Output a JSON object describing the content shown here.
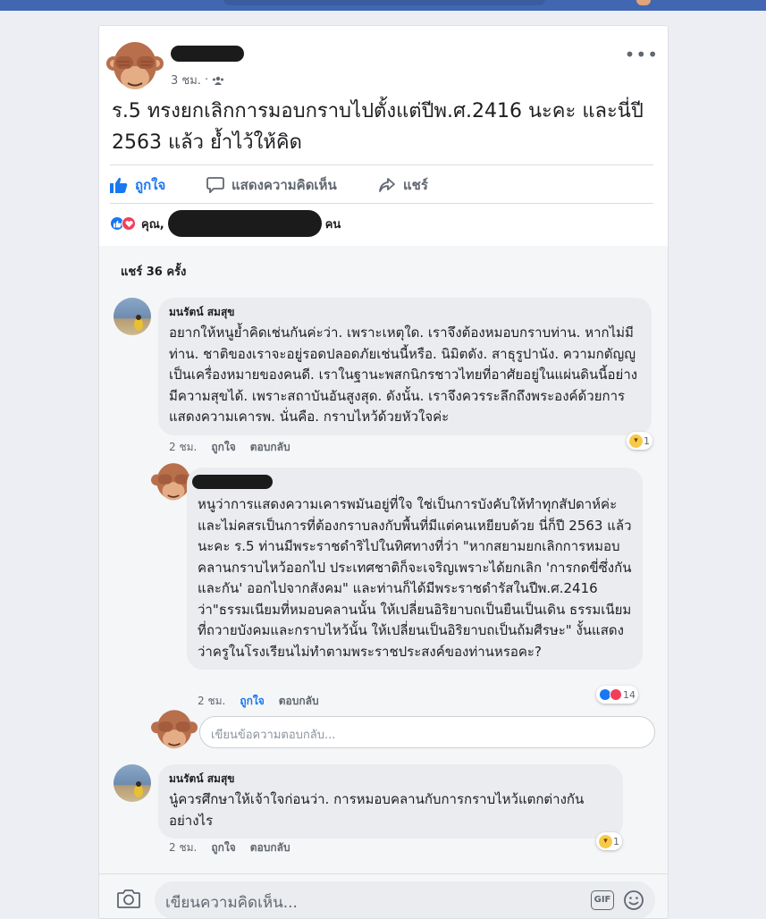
{
  "post": {
    "author_name": "",
    "time": "3 ชม.",
    "audience_icon": "friends-icon",
    "more_icon": "more-dots-icon",
    "text": "ร.5 ทรงยกเลิกการมอบกราบไปตั้งแต่ปีพ.ศ.2416 นะคะ และนี่ปี 2563 แล้ว ย้ำไว้ให้คิด"
  },
  "actions": {
    "like_label": "ถูกใจ",
    "comment_label": "แสดงความคิดเห็น",
    "share_label": "แชร์"
  },
  "reactions": {
    "icons": [
      "like-icon",
      "love-icon"
    ],
    "prefix": "คุณ,",
    "suffix": "คน"
  },
  "shares_text": "แชร์ 36 ครั้ง",
  "comments": [
    {
      "author": "มนรัตน์ สมสุข",
      "text": "อยากให้หนูย้ำคิดเช่นกันค่ะว่า. เพราะเหตุใด. เราจึงต้องหมอบกราบท่าน. หากไม่มีท่าน. ชาติของเราจะอยู่รอดปลอดภัยเช่นนี้หรือ. นิมิตดัง.  สาธุรูปานัง. ความกตัญญูเป็นเครื่องหมายของคนดี.  เราในฐานะพสกนิกรชาวไทยที่อาศัยอยู่ในแผ่นดินนี้อย่างมีความสุขได้. เพราะสถาบันอันสูงสุด.  ดังนั้น.  เราจึงควรระลึกถึงพระองค์ด้วยการแสดงความเคารพ. นั่นคือ.  กราบไหว้ด้วยหัวใจค่ะ",
      "time": "2 ชม.",
      "like": "ถูกใจ",
      "reply": "ตอบกลับ",
      "reaction_count": "1"
    },
    {
      "author": "",
      "text": "หนูว่าการแสดงความเคารพมันอยู่ที่ใจ ใช่เป็นการบังคับให้ทำทุกสัปดาห์ค่ะ และไม่คสรเป็นการที่ต้องกราบลงกับพื้นที่มีแต่คนเหยียบด้วย นี่ก็ปี 2563 แล้วนะคะ ร.5 ท่านมีพระราชดำริไปในทิศทางที่ว่า \"หากสยามยกเลิกการหมอบคลานกราบไหว้ออกไป ประเทศชาติก็จะเจริญเพราะได้ยกเลิก 'การกดขี่ซึ่งกันและกัน' ออกไปจากสังคม\" และท่านก็ได้มีพระราชดำรัสในปีพ.ศ.2416 ว่า\"ธรรมเนียมที่หมอบคลานนั้น ให้เปลี่ยนอิริยาบถเป็นยืนเป็นเดิน ธรรมเนียมที่ถวายบังคมและกราบไหว้นั้น ให้เปลี่ยนเป็นอิริยาบถเป็นถ้มศีรษะ\" งั้นแสดงว่าครูในโรงเรียนไม่ทำตามพระราชประสงค์ของท่านหรอคะ?",
      "time": "2 ชม.",
      "like": "ถูกใจ",
      "reply": "ตอบกลับ",
      "reaction_count": "14"
    },
    {
      "author": "มนรัตน์ สมสุข",
      "text": "นู๋ควรศึกษาให้เจ้าใจก่อนว่า. การหมอบคลานกับการกราบไหว้แตกต่างกันอย่างไร",
      "time": "2 ชม.",
      "like": "ถูกใจ",
      "reply": "ตอบกลับ",
      "reaction_count": "1"
    }
  ],
  "reply_placeholder": "เขียนข้อความตอบกลับ...",
  "compose": {
    "placeholder": "เขียนความคิดเห็น...",
    "camera_icon": "camera-icon",
    "gif_label": "GIF",
    "emoji_icon": "smiley-icon"
  },
  "colors": {
    "brand": "#4267b2",
    "link": "#1877f2",
    "like_red": "#f33e58",
    "haha_yellow": "#f7c948"
  }
}
